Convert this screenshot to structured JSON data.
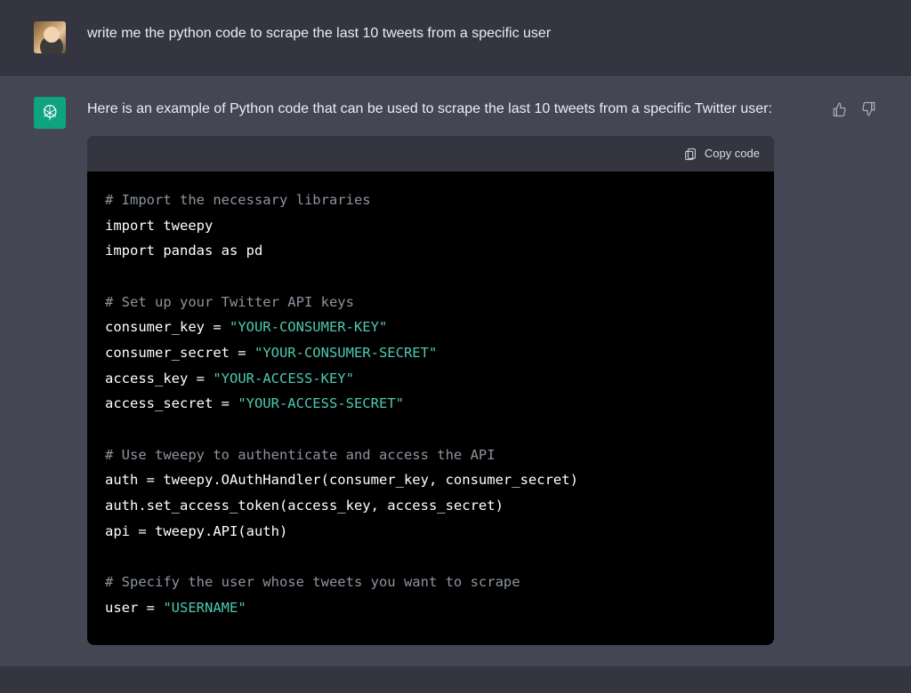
{
  "user_message": {
    "text": "write me the python code to scrape the last 10 tweets from a specific user"
  },
  "assistant_message": {
    "intro": "Here is an example of Python code that can be used to scrape the last 10 tweets from a specific Twitter user:"
  },
  "code_block": {
    "copy_label": "Copy code",
    "lines": [
      {
        "tokens": [
          {
            "t": "# Import the necessary libraries",
            "c": "comment"
          }
        ]
      },
      {
        "tokens": [
          {
            "t": "import",
            "c": "keyword"
          },
          {
            "t": " tweepy",
            "c": "ident"
          }
        ]
      },
      {
        "tokens": [
          {
            "t": "import",
            "c": "keyword"
          },
          {
            "t": " pandas ",
            "c": "ident"
          },
          {
            "t": "as",
            "c": "keyword"
          },
          {
            "t": " pd",
            "c": "ident"
          }
        ]
      },
      {
        "tokens": [
          {
            "t": "",
            "c": "ident"
          }
        ]
      },
      {
        "tokens": [
          {
            "t": "# Set up your Twitter API keys",
            "c": "comment"
          }
        ]
      },
      {
        "tokens": [
          {
            "t": "consumer_key = ",
            "c": "ident"
          },
          {
            "t": "\"YOUR-CONSUMER-KEY\"",
            "c": "string"
          }
        ]
      },
      {
        "tokens": [
          {
            "t": "consumer_secret = ",
            "c": "ident"
          },
          {
            "t": "\"YOUR-CONSUMER-SECRET\"",
            "c": "string"
          }
        ]
      },
      {
        "tokens": [
          {
            "t": "access_key = ",
            "c": "ident"
          },
          {
            "t": "\"YOUR-ACCESS-KEY\"",
            "c": "string"
          }
        ]
      },
      {
        "tokens": [
          {
            "t": "access_secret = ",
            "c": "ident"
          },
          {
            "t": "\"YOUR-ACCESS-SECRET\"",
            "c": "string"
          }
        ]
      },
      {
        "tokens": [
          {
            "t": "",
            "c": "ident"
          }
        ]
      },
      {
        "tokens": [
          {
            "t": "# Use tweepy to authenticate and access the API",
            "c": "comment"
          }
        ]
      },
      {
        "tokens": [
          {
            "t": "auth = tweepy.OAuthHandler(consumer_key, consumer_secret)",
            "c": "ident"
          }
        ]
      },
      {
        "tokens": [
          {
            "t": "auth.set_access_token(access_key, access_secret)",
            "c": "ident"
          }
        ]
      },
      {
        "tokens": [
          {
            "t": "api = tweepy.API(auth)",
            "c": "ident"
          }
        ]
      },
      {
        "tokens": [
          {
            "t": "",
            "c": "ident"
          }
        ]
      },
      {
        "tokens": [
          {
            "t": "# Specify the user whose tweets you want to scrape",
            "c": "comment"
          }
        ]
      },
      {
        "tokens": [
          {
            "t": "user = ",
            "c": "ident"
          },
          {
            "t": "\"USERNAME\"",
            "c": "string"
          }
        ]
      }
    ]
  }
}
